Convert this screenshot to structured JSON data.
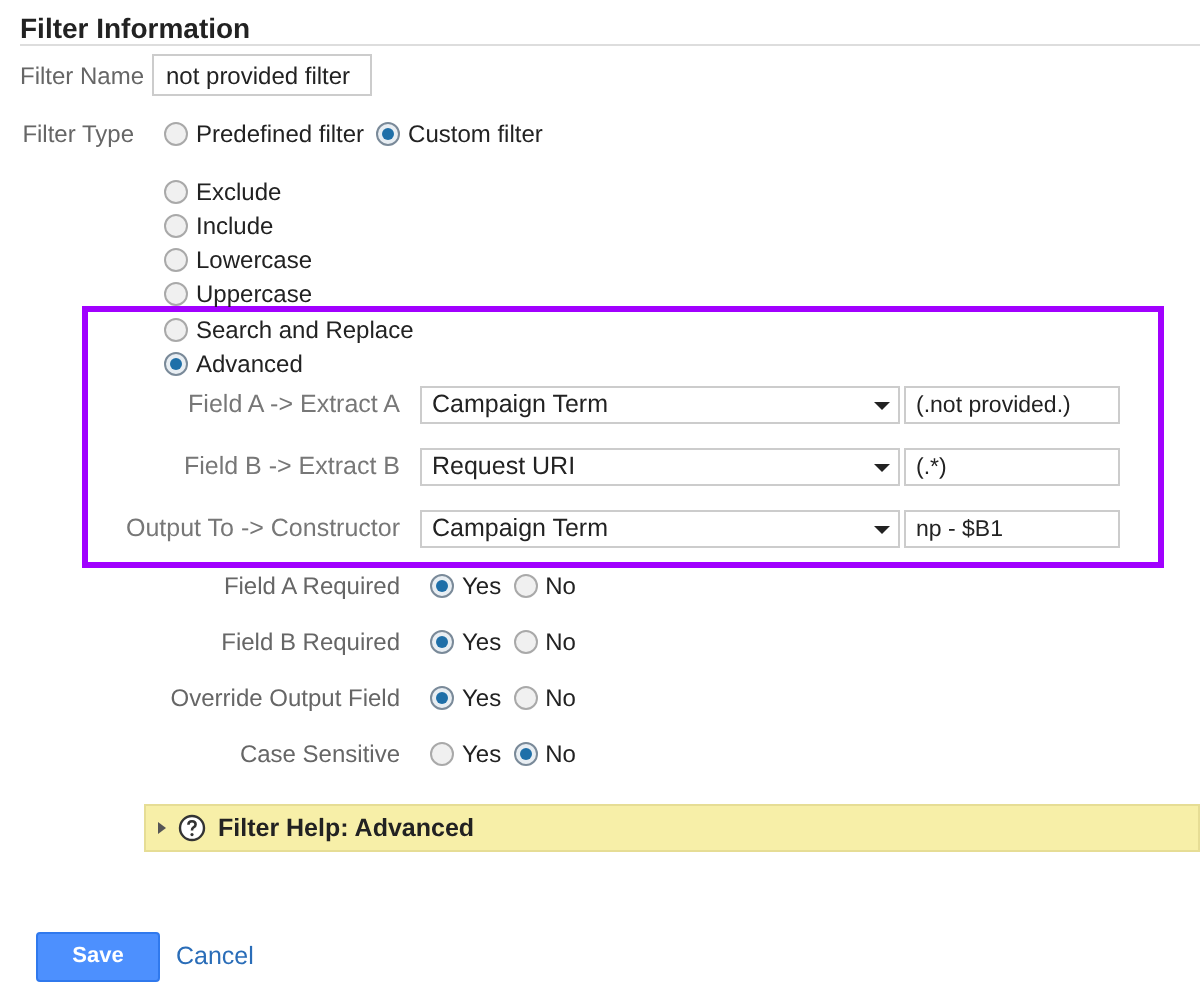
{
  "title": "Filter Information",
  "filter_name": {
    "label": "Filter Name",
    "value": "not provided filter"
  },
  "filter_type": {
    "label": "Filter Type",
    "options": [
      {
        "label": "Predefined filter",
        "selected": false
      },
      {
        "label": "Custom filter",
        "selected": true
      }
    ]
  },
  "custom_options": [
    {
      "label": "Exclude",
      "selected": false
    },
    {
      "label": "Include",
      "selected": false
    },
    {
      "label": "Lowercase",
      "selected": false
    },
    {
      "label": "Uppercase",
      "selected": false
    },
    {
      "label": "Search and Replace",
      "selected": false
    },
    {
      "label": "Advanced",
      "selected": true
    }
  ],
  "advanced_fields": [
    {
      "label": "Field A -> Extract A",
      "select": "Campaign Term",
      "value": "(.not provided.)"
    },
    {
      "label": "Field B -> Extract B",
      "select": "Request URI",
      "value": "(.*)"
    },
    {
      "label": "Output To -> Constructor",
      "select": "Campaign Term",
      "value": "np - $B1"
    }
  ],
  "toggles": [
    {
      "label": "Field A Required",
      "options": [
        {
          "label": "Yes",
          "selected": true
        },
        {
          "label": "No",
          "selected": false
        }
      ]
    },
    {
      "label": "Field B Required",
      "options": [
        {
          "label": "Yes",
          "selected": true
        },
        {
          "label": "No",
          "selected": false
        }
      ]
    },
    {
      "label": "Override Output Field",
      "options": [
        {
          "label": "Yes",
          "selected": true
        },
        {
          "label": "No",
          "selected": false
        }
      ]
    },
    {
      "label": "Case Sensitive",
      "options": [
        {
          "label": "Yes",
          "selected": false
        },
        {
          "label": "No",
          "selected": true
        }
      ]
    }
  ],
  "help": {
    "title": "Filter Help: Advanced",
    "expanded": false
  },
  "buttons": {
    "save": "Save",
    "cancel": "Cancel"
  }
}
